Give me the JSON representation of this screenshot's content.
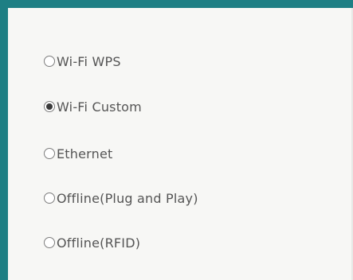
{
  "connection_options": [
    {
      "label": "Wi-Fi WPS",
      "selected": false
    },
    {
      "label": "Wi-Fi Custom",
      "selected": true
    },
    {
      "label": "Ethernet",
      "selected": false
    },
    {
      "label": "Offline(Plug and Play)",
      "selected": false
    },
    {
      "label": "Offline(RFID)",
      "selected": false
    }
  ],
  "colors": {
    "frame": "#1e7f84",
    "panel": "#f7f7f5",
    "text": "#555555"
  }
}
